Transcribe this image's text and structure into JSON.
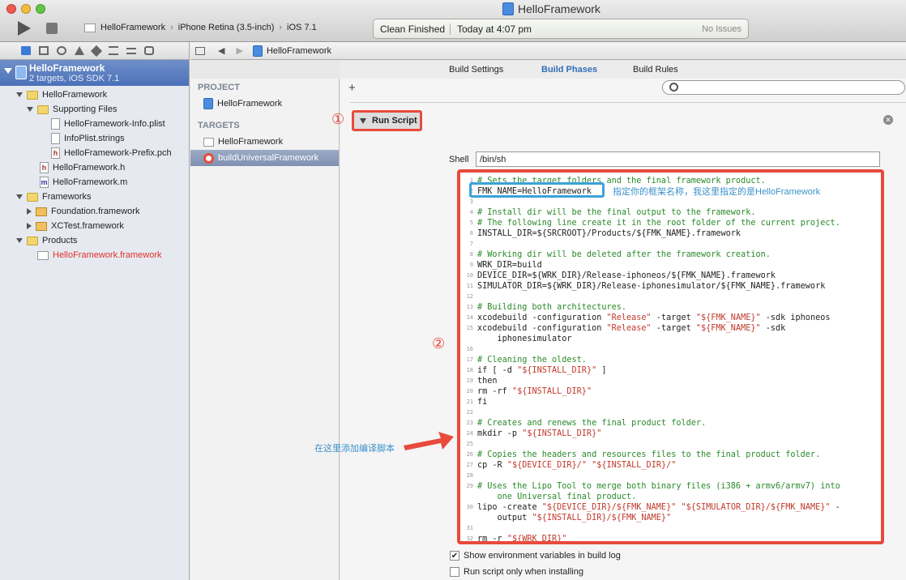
{
  "window": {
    "title": "HelloFramework"
  },
  "toolbar": {
    "scheme": "HelloFramework",
    "device": "iPhone Retina (3.5-inch)",
    "sdk": "iOS 7.1",
    "status_left": "Clean Finished",
    "status_mid": "Today at 4:07 pm",
    "status_right": "No Issues"
  },
  "navigator": {
    "project_name": "HelloFramework",
    "project_sub": "2 targets, iOS SDK 7.1",
    "items": [
      {
        "label": "HelloFramework"
      },
      {
        "label": "Supporting Files"
      },
      {
        "label": "HelloFramework-Info.plist"
      },
      {
        "label": "InfoPlist.strings"
      },
      {
        "label": "HelloFramework-Prefix.pch"
      },
      {
        "label": "HelloFramework.h"
      },
      {
        "label": "HelloFramework.m"
      },
      {
        "label": "Frameworks"
      },
      {
        "label": "Foundation.framework"
      },
      {
        "label": "XCTest.framework"
      },
      {
        "label": "Products"
      },
      {
        "label": "HelloFramework.framework"
      }
    ]
  },
  "jumpbar": {
    "file": "HelloFramework"
  },
  "tabs": {
    "settings": "Build Settings",
    "phases": "Build Phases",
    "rules": "Build Rules"
  },
  "projectlist": {
    "project_header": "PROJECT",
    "project_item": "HelloFramework",
    "targets_header": "TARGETS",
    "target1": "HelloFramework",
    "target2": "buildUniversalFramework"
  },
  "phase": {
    "title": "Run Script",
    "shell_label": "Shell",
    "shell_value": "/bin/sh",
    "code": [
      {
        "n": "1",
        "t": "# Sets the target folders and the final framework product.",
        "c": true
      },
      {
        "n": "2",
        "t": "FMK_NAME=HelloFramework",
        "c": false
      },
      {
        "n": "3",
        "t": "",
        "c": false
      },
      {
        "n": "4",
        "t": "# Install dir will be the final output to the framework.",
        "c": true
      },
      {
        "n": "5",
        "t": "# The following line create it in the root folder of the current project.",
        "c": true
      },
      {
        "n": "6",
        "t": "INSTALL_DIR=${SRCROOT}/Products/${FMK_NAME}.framework",
        "c": false
      },
      {
        "n": "7",
        "t": "",
        "c": false
      },
      {
        "n": "8",
        "t": "# Working dir will be deleted after the framework creation.",
        "c": true
      },
      {
        "n": "9",
        "t": "WRK_DIR=build",
        "c": false
      },
      {
        "n": "10",
        "t": "DEVICE_DIR=${WRK_DIR}/Release-iphoneos/${FMK_NAME}.framework",
        "c": false
      },
      {
        "n": "11",
        "t": "SIMULATOR_DIR=${WRK_DIR}/Release-iphonesimulator/${FMK_NAME}.framework",
        "c": false
      },
      {
        "n": "12",
        "t": "",
        "c": false
      },
      {
        "n": "13",
        "t": "# Building both architectures.",
        "c": true
      },
      {
        "n": "14",
        "t": "xcodebuild -configuration \"Release\" -target \"${FMK_NAME}\" -sdk iphoneos",
        "c": false
      },
      {
        "n": "15",
        "t": "xcodebuild -configuration \"Release\" -target \"${FMK_NAME}\" -sdk",
        "c": false
      },
      {
        "n": "",
        "t": "    iphonesimulator",
        "c": false
      },
      {
        "n": "16",
        "t": "",
        "c": false
      },
      {
        "n": "17",
        "t": "# Cleaning the oldest.",
        "c": true
      },
      {
        "n": "18",
        "t": "if [ -d \"${INSTALL_DIR}\" ]",
        "c": false
      },
      {
        "n": "19",
        "t": "then",
        "c": false
      },
      {
        "n": "20",
        "t": "rm -rf \"${INSTALL_DIR}\"",
        "c": false
      },
      {
        "n": "21",
        "t": "fi",
        "c": false
      },
      {
        "n": "22",
        "t": "",
        "c": false
      },
      {
        "n": "23",
        "t": "# Creates and renews the final product folder.",
        "c": true
      },
      {
        "n": "24",
        "t": "mkdir -p \"${INSTALL_DIR}\"",
        "c": false
      },
      {
        "n": "25",
        "t": "",
        "c": false
      },
      {
        "n": "26",
        "t": "# Copies the headers and resources files to the final product folder.",
        "c": true
      },
      {
        "n": "27",
        "t": "cp -R \"${DEVICE_DIR}/\" \"${INSTALL_DIR}/\"",
        "c": false
      },
      {
        "n": "28",
        "t": "",
        "c": false
      },
      {
        "n": "29",
        "t": "# Uses the Lipo Tool to merge both binary files (i386 + armv6/armv7) into",
        "c": true
      },
      {
        "n": "",
        "t": "    one Universal final product.",
        "c": true
      },
      {
        "n": "30",
        "t": "lipo -create \"${DEVICE_DIR}/${FMK_NAME}\" \"${SIMULATOR_DIR}/${FMK_NAME}\" -",
        "c": false
      },
      {
        "n": "",
        "t": "    output \"${INSTALL_DIR}/${FMK_NAME}\"",
        "c": false
      },
      {
        "n": "31",
        "t": "",
        "c": false
      },
      {
        "n": "32",
        "t": "rm -r \"${WRK_DIR}\"",
        "c": false
      }
    ],
    "check1": "Show environment variables in build log",
    "check2": "Run script only when installing"
  },
  "annotations": {
    "circle1": "①",
    "circle2": "②",
    "note_fmk": "指定你的框架名称，我这里指定的是HelloFramework",
    "note_add": "在这里添加编译脚本"
  },
  "colors": {
    "annotation_red": "#e84a3c",
    "annotation_blue": "#3ba3d9",
    "comment_green": "#2a8a2a",
    "string_red": "#c0392b",
    "tab_active": "#2e6fba"
  }
}
